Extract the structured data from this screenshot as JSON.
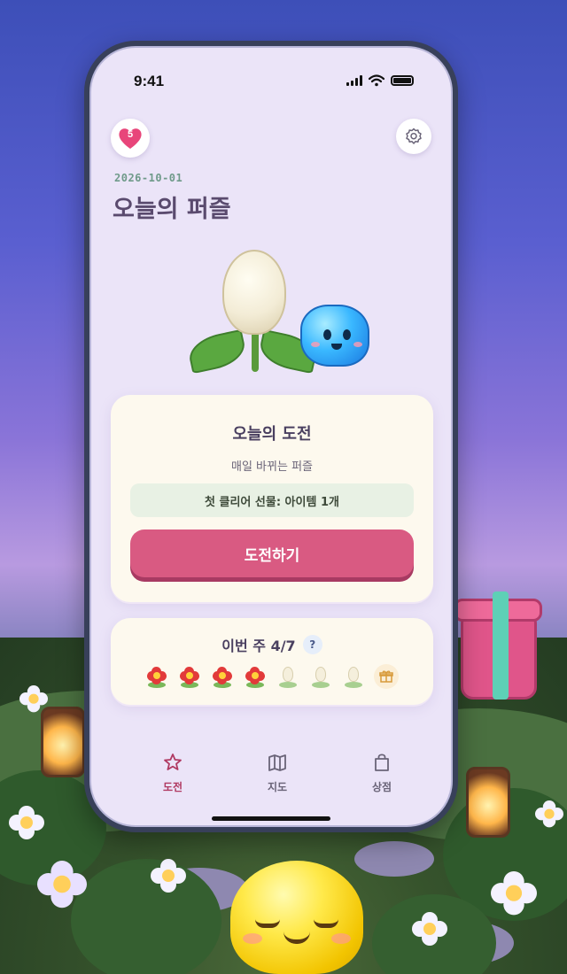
{
  "status_bar": {
    "time": "9:41"
  },
  "header": {
    "hearts_count": "5",
    "date": "2026-10-01",
    "title": "오늘의 퍼즐"
  },
  "challenge_card": {
    "title": "오늘의 도전",
    "subtitle": "매일 바뀌는 퍼즐",
    "reward_text": "첫 클리어 선물: 아이템 1개",
    "cta_label": "도전하기"
  },
  "weekly": {
    "label": "이번 주 4/7",
    "help_label": "?",
    "completed_days": 4,
    "total_days": 7,
    "days": [
      "flower-red",
      "flower-red",
      "flower-red",
      "flower-red",
      "bud-white",
      "bud-white",
      "bud-white"
    ],
    "bonus": "gift-icon"
  },
  "tabs": [
    {
      "label": "도전",
      "icon": "star-icon",
      "active": true
    },
    {
      "label": "지도",
      "icon": "map-icon",
      "active": false
    },
    {
      "label": "상점",
      "icon": "bag-icon",
      "active": false
    }
  ],
  "colors": {
    "primary": "#d95a82",
    "active_tab": "#b03a62",
    "inactive_tab": "#6a6478",
    "date": "#6f9a8a",
    "title": "#5a4a6e"
  }
}
